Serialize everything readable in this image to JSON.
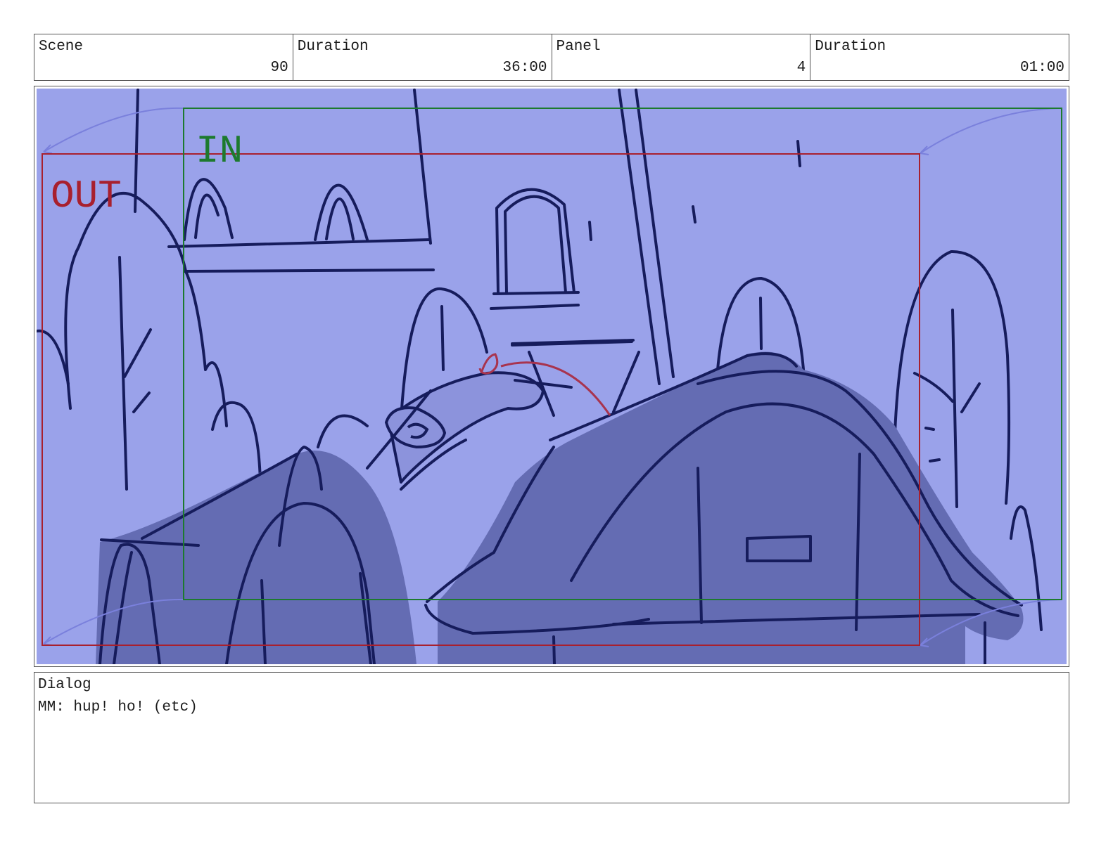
{
  "header": {
    "scene_label": "Scene",
    "scene_value": "90",
    "scene_duration_label": "Duration",
    "scene_duration_value": "36:00",
    "panel_label": "Panel",
    "panel_value": "4",
    "panel_duration_label": "Duration",
    "panel_duration_value": "01:00"
  },
  "panel": {
    "in_label": "IN",
    "out_label": "OUT",
    "colors": {
      "background": "#9aa2ea",
      "ink": "#161c5c",
      "shadow": "#646cb3",
      "in_frame": "#1d7a2e",
      "out_frame": "#a8202e",
      "arrow": "#7a80dc",
      "note": "#a8344e"
    }
  },
  "dialog": {
    "label": "Dialog",
    "text": "MM: hup! ho! (etc)"
  }
}
